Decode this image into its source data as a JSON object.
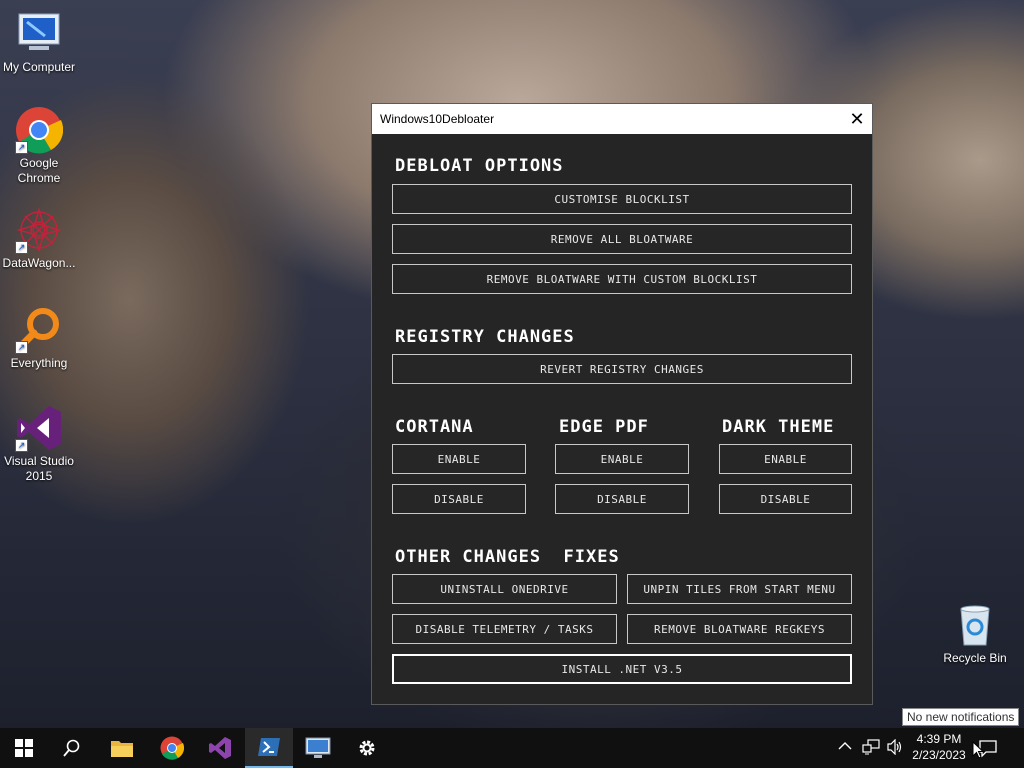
{
  "desktop": {
    "icons": [
      {
        "label": "My Computer",
        "icon": "computer-icon"
      },
      {
        "label": "Google Chrome",
        "icon": "chrome-icon"
      },
      {
        "label": "DataWagon...",
        "icon": "datawagon-icon"
      },
      {
        "label": "Everything",
        "icon": "everything-icon"
      },
      {
        "label": "Visual Studio 2015",
        "icon": "visual-studio-icon"
      }
    ],
    "recycle_bin": "Recycle Bin"
  },
  "window": {
    "title": "Windows10Debloater",
    "sections": {
      "debloat": "DEBLOAT OPTIONS",
      "registry": "REGISTRY CHANGES",
      "cortana": "CORTANA",
      "edge_pdf": "EDGE PDF",
      "dark_theme": "DARK THEME",
      "other": "OTHER CHANGES  FIXES"
    },
    "buttons": {
      "customise_blocklist": "CUSTOMISE BLOCKLIST",
      "remove_all_bloatware": "REMOVE ALL BLOATWARE",
      "remove_custom_blocklist": "REMOVE BLOATWARE WITH CUSTOM BLOCKLIST",
      "revert_registry": "REVERT REGISTRY CHANGES",
      "enable": "ENABLE",
      "disable": "DISABLE",
      "uninstall_onedrive": "UNINSTALL ONEDRIVE",
      "unpin_tiles": "UNPIN TILES FROM START MENU",
      "disable_telemetry": "DISABLE TELEMETRY / TASKS",
      "remove_regkeys": "REMOVE BLOATWARE REGKEYS",
      "install_net": "INSTALL .NET V3.5"
    }
  },
  "taskbar": {
    "items": [
      "windows-start-icon",
      "search-icon",
      "file-explorer-icon",
      "chrome-icon",
      "visual-studio-icon",
      "powershell-icon",
      "remote-desktop-icon",
      "settings-gear-icon"
    ],
    "time": "4:39 PM",
    "date": "2/23/2023",
    "tooltip": "No new notifications"
  }
}
